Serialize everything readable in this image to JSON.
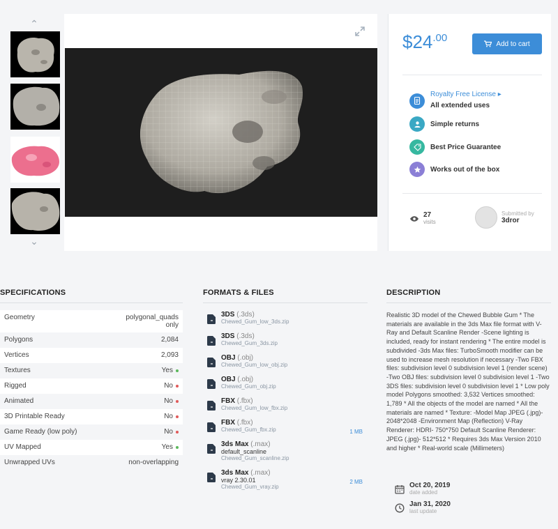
{
  "gallery": {
    "thumbnails": [
      "thumb-1",
      "thumb-2",
      "thumb-3",
      "thumb-4"
    ]
  },
  "purchase": {
    "price_currency": "$",
    "price_whole": "24",
    "price_cents": ".00",
    "cart_label": "Add to cart",
    "perks": [
      {
        "link": "Royalty Free License ▸",
        "label": "All extended uses",
        "icon": "document-icon",
        "color": "#3c8dd8"
      },
      {
        "label": "Simple returns",
        "icon": "person-icon",
        "color": "#3aa8c4"
      },
      {
        "label": "Best Price Guarantee",
        "icon": "tag-icon",
        "color": "#36b8a0"
      },
      {
        "label": "Works out of the box",
        "icon": "star-icon",
        "color": "#8b7fd6"
      }
    ],
    "views_count": "27",
    "views_label": "visits",
    "submitted_by_label": "Submitted by",
    "submitter": "3dror"
  },
  "specifications": {
    "title": "SPECIFICATIONS",
    "rows": [
      {
        "k": "Geometry",
        "v": "polygonal_quads only"
      },
      {
        "k": "Polygons",
        "v": "2,084"
      },
      {
        "k": "Vertices",
        "v": "2,093"
      },
      {
        "k": "Textures",
        "v": "Yes",
        "status": "#5cb85c"
      },
      {
        "k": "Rigged",
        "v": "No",
        "status": "#e05a5a"
      },
      {
        "k": "Animated",
        "v": "No",
        "status": "#e05a5a"
      },
      {
        "k": "3D Printable Ready",
        "v": "No",
        "status": "#e05a5a"
      },
      {
        "k": "Game Ready (low poly)",
        "v": "No",
        "status": "#e05a5a"
      },
      {
        "k": "UV Mapped",
        "v": "Yes",
        "status": "#5cb85c"
      },
      {
        "k": "Unwrapped UVs",
        "v": "non-overlapping"
      }
    ]
  },
  "formats": {
    "title": "FORMATS & FILES",
    "files": [
      {
        "name": "3DS",
        "ext": "(.3ds)",
        "sub": "",
        "zip": "Chewed_Gum_low_3ds.zip",
        "size": ""
      },
      {
        "name": "3DS",
        "ext": "(.3ds)",
        "sub": "",
        "zip": "Chewed_Gum_3ds.zip",
        "size": ""
      },
      {
        "name": "OBJ",
        "ext": "(.obj)",
        "sub": "",
        "zip": "Chewed_Gum_low_obj.zip",
        "size": ""
      },
      {
        "name": "OBJ",
        "ext": "(.obj)",
        "sub": "",
        "zip": "Chewed_Gum_obj.zip",
        "size": ""
      },
      {
        "name": "FBX",
        "ext": "(.fbx)",
        "sub": "",
        "zip": "Chewed_Gum_low_fbx.zip",
        "size": ""
      },
      {
        "name": "FBX",
        "ext": "(.fbx)",
        "sub": "",
        "zip": "Chewed_Gum_fbx.zip",
        "size": "1 MB"
      },
      {
        "name": "3ds Max",
        "ext": "(.max)",
        "sub": "default_scanline",
        "zip": "Chewed_Gum_scanline.zip",
        "size": ""
      },
      {
        "name": "3ds Max",
        "ext": "(.max)",
        "sub": "vray 2.30.01",
        "zip": "Chewed_Gum_vray.zip",
        "size": "2 MB"
      }
    ]
  },
  "description": {
    "title": "DESCRIPTION",
    "text": "Realistic 3D model of the Chewed Bubble Gum * The materials are available in the 3ds Max file format with V-Ray and Default Scanline Render -Scene lighting is included, ready for instant rendering * The entire model is subdivided -3ds Max files: TurboSmooth modifier can be used to increase mesh resolution if necessary -Two FBX files: subdivision level 0 subdivision level 1 (render scene) -Two OBJ files: subdivision level 0 subdivision level 1 -Two 3DS files: subdivision level 0 subdivision level 1 * Low poly model Polygons smoothed: 3,532 Vertices smoothed: 1,789 * All the objects of the model are named * All the materials are named * Texture: -Model Map JPEG (.jpg)- 2048*2048 -Environment Map (Reflection) V-Ray Renderer: HDRI- 750*750 Default Scanline Renderer: JPEG (.jpg)- 512*512 * Requires 3ds Max Version 2010 and higher * Real-world scale (Millimeters)",
    "date_added": "Oct 20, 2019",
    "date_added_label": "date added",
    "last_update": "Jan 31, 2020",
    "last_update_label": "last update"
  }
}
